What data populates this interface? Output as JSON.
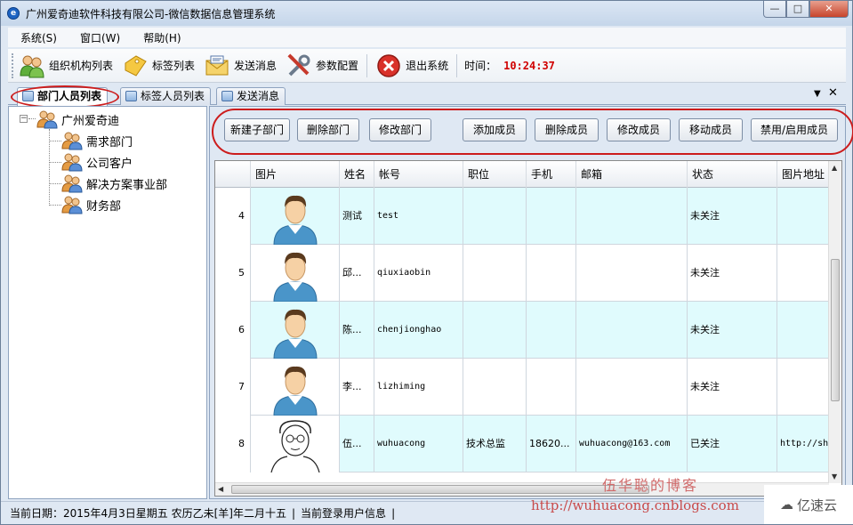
{
  "window": {
    "title": "广州爱奇迪软件科技有限公司-微信数据信息管理系统",
    "controls": [
      "minimize",
      "maximize",
      "close"
    ]
  },
  "menu": [
    {
      "label": "系统(S)"
    },
    {
      "label": "窗口(W)"
    },
    {
      "label": "帮助(H)"
    }
  ],
  "toolbar": {
    "buttons": [
      {
        "label": "组织机构列表",
        "icon": "people-group-icon"
      },
      {
        "label": "标签列表",
        "icon": "tag-icon"
      },
      {
        "label": "发送消息",
        "icon": "envelope-icon"
      },
      {
        "label": "参数配置",
        "icon": "tools-icon"
      },
      {
        "label": "退出系统",
        "icon": "exit-icon"
      }
    ],
    "time_label": "时间：",
    "time_value": "10:24:37"
  },
  "tabs": [
    {
      "label": "部门人员列表",
      "active": true
    },
    {
      "label": "标签人员列表",
      "active": false
    },
    {
      "label": "发送消息",
      "active": false
    }
  ],
  "tree": {
    "root": "广州爱奇迪",
    "children": [
      "需求部门",
      "公司客户",
      "解决方案事业部",
      "财务部"
    ]
  },
  "actions": [
    "新建子部门",
    "删除部门",
    "修改部门",
    "添加成员",
    "删除成员",
    "修改成员",
    "移动成员",
    "禁用/启用成员"
  ],
  "grid": {
    "columns": [
      "图片",
      "姓名",
      "帐号",
      "职位",
      "手机",
      "邮箱",
      "状态",
      "图片地址"
    ],
    "rows": [
      {
        "num": "4",
        "name": "测试",
        "account": "test",
        "position": "",
        "phone": "",
        "email": "",
        "status": "未关注",
        "img_url": "",
        "avatar": "default"
      },
      {
        "num": "5",
        "name": "邱...",
        "account": "qiuxiaobin",
        "position": "",
        "phone": "",
        "email": "",
        "status": "未关注",
        "img_url": "",
        "avatar": "default"
      },
      {
        "num": "6",
        "name": "陈...",
        "account": "chenjionghao",
        "position": "",
        "phone": "",
        "email": "",
        "status": "未关注",
        "img_url": "",
        "avatar": "default"
      },
      {
        "num": "7",
        "name": "李...",
        "account": "lizhiming",
        "position": "",
        "phone": "",
        "email": "",
        "status": "未关注",
        "img_url": "",
        "avatar": "default"
      },
      {
        "num": "8",
        "name": "伍...",
        "account": "wuhuacong",
        "position": "技术总监",
        "phone": "18620...",
        "email": "wuhuacong@163.com",
        "status": "已关注",
        "img_url": "http://sh",
        "avatar": "sketch"
      }
    ]
  },
  "status": {
    "date_text": "当前日期：2015年4月3日星期五 农历乙未[羊]年二月十五",
    "user_text": "当前登录用户信息"
  },
  "watermark": {
    "blog": "伍华聪的博客",
    "url": "http://wuhuacong.cnblogs.com",
    "logo": "亿速云"
  },
  "colors": {
    "time": "#d00000",
    "alt_row": "#e0fbfd",
    "highlight": "#cc1c1c"
  }
}
